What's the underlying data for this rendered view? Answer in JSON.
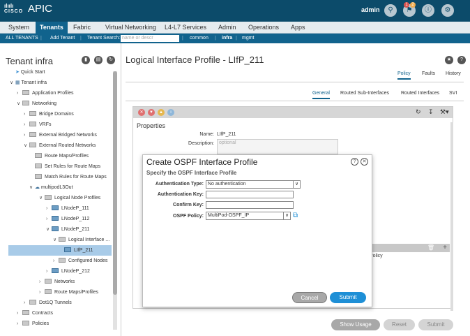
{
  "app": {
    "logo_text": "CISCO",
    "title": "APIC",
    "user": "admin",
    "alerts_badge": "1",
    "tasks_badge": "2"
  },
  "menu": [
    "System",
    "Tenants",
    "Fabric",
    "Virtual Networking",
    "L4-L7 Services",
    "Admin",
    "Operations",
    "Apps"
  ],
  "submenu": {
    "all_tenants": "ALL TENANTS",
    "add_tenant": "Add Tenant",
    "tenant_search": "Tenant Search:",
    "search_placeholder": "name or descr",
    "common": "common",
    "infra": "infra",
    "mgmt": "mgmt"
  },
  "sidebar": {
    "title": "Tenant infra",
    "tree": [
      {
        "label": "Quick Start"
      },
      {
        "label": "Tenant infra"
      },
      {
        "label": "Application Profiles"
      },
      {
        "label": "Networking"
      },
      {
        "label": "Bridge Domains"
      },
      {
        "label": "VRFs"
      },
      {
        "label": "External Bridged Networks"
      },
      {
        "label": "External Routed Networks"
      },
      {
        "label": "Route Maps/Profiles"
      },
      {
        "label": "Set Rules for Route Maps"
      },
      {
        "label": "Match Rules for Route Maps"
      },
      {
        "label": "multipodL3Out"
      },
      {
        "label": "Logical Node Profiles"
      },
      {
        "label": "LNodeP_111"
      },
      {
        "label": "LNodeP_112"
      },
      {
        "label": "LNodeP_211"
      },
      {
        "label": "Logical Interface ..."
      },
      {
        "label": "LIfP_211"
      },
      {
        "label": "Configured Nodes"
      },
      {
        "label": "LNodeP_212"
      },
      {
        "label": "Networks"
      },
      {
        "label": "Route Maps/Profiles"
      },
      {
        "label": "Dot1Q Tunnels"
      },
      {
        "label": "Contracts"
      },
      {
        "label": "Policies"
      }
    ]
  },
  "main": {
    "title": "Logical Interface Profile - LIfP_211",
    "tabs": [
      "Policy",
      "Faults",
      "History"
    ],
    "subtabs": [
      "General",
      "Routed Sub-Interfaces",
      "Routed Interfaces",
      "SVI"
    ],
    "properties_label": "Properties",
    "name_label": "Name:",
    "name_value": "LIfP_211",
    "description_label": "Description:",
    "description_placeholder": "optional",
    "table_col": "Policy",
    "buttons": {
      "show_usage": "Show Usage",
      "reset": "Reset",
      "submit": "Submit"
    }
  },
  "dialog": {
    "title": "Create OSPF Interface Profile",
    "subtitle": "Specify the OSPF Interface Profile",
    "auth_type_label": "Authentication Type:",
    "auth_type_value": "No authentication",
    "auth_key_label": "Authentication Key:",
    "confirm_key_label": "Confirm Key:",
    "ospf_policy_label": "OSPF Policy:",
    "ospf_policy_value": "MultiPod-OSPF_IP",
    "cancel": "Cancel",
    "submit": "Submit"
  },
  "colors": {
    "topbar": "#0c4b6a",
    "accent": "#11638d",
    "selected_row": "#a8cbe8",
    "submit_button": "#1e8fd6"
  }
}
